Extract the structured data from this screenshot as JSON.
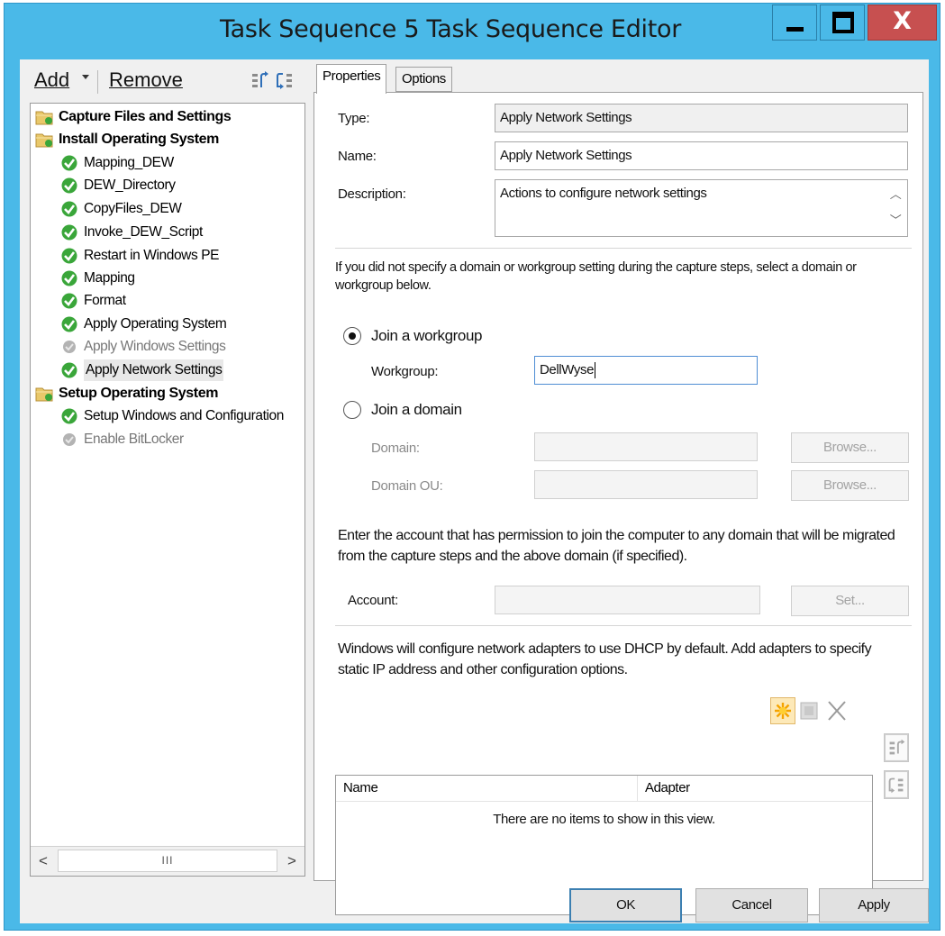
{
  "window": {
    "title": "Task Sequence 5 Task Sequence Editor",
    "minimize_glyph": "",
    "close_glyph": "X"
  },
  "toolbar": {
    "add_label": "Add",
    "remove_label": "Remove"
  },
  "tree": {
    "groups": [
      {
        "label": "Capture Files and Settings"
      },
      {
        "label": "Install Operating System"
      },
      {
        "label": "Setup Operating System"
      }
    ],
    "steps": [
      {
        "label": "Mapping_DEW",
        "status": "check"
      },
      {
        "label": "DEW_Directory",
        "status": "check"
      },
      {
        "label": "CopyFiles_DEW",
        "status": "check"
      },
      {
        "label": "Invoke_DEW_Script",
        "status": "check"
      },
      {
        "label": "Restart in Windows PE",
        "status": "check"
      },
      {
        "label": "Mapping",
        "status": "check"
      },
      {
        "label": "Format",
        "status": "check"
      },
      {
        "label": "Apply Operating System",
        "status": "check"
      },
      {
        "label": "Apply Windows Settings",
        "status": "disabled"
      },
      {
        "label": "Apply Network Settings",
        "status": "check",
        "selected": true
      },
      {
        "label": "Setup Windows and Configuration",
        "status": "check"
      },
      {
        "label": "Enable BitLocker",
        "status": "disabled"
      }
    ],
    "scroll": {
      "left": "<",
      "thumb": "III",
      "right": ">"
    }
  },
  "tabs": [
    {
      "label": "Properties",
      "active": true
    },
    {
      "label": "Options",
      "active": false
    }
  ],
  "properties": {
    "type_label": "Type:",
    "type_value": "Apply Network Settings",
    "name_label": "Name:",
    "name_value": "Apply Network Settings",
    "description_label": "Description:",
    "description_value": "Actions to configure network settings",
    "domain_help": "If you did not specify a domain or workgroup setting during the capture steps, select a domain or workgroup below.",
    "join_workgroup_label": "Join a workgroup",
    "workgroup_label": "Workgroup:",
    "workgroup_value": "DellWyse",
    "join_domain_label": "Join a domain",
    "domain_label": "Domain:",
    "domain_ou_label": "Domain OU:",
    "browse_label": "Browse...",
    "account_help": "Enter the account that has permission to join the computer to any domain that will be migrated from the capture steps and the above domain (if specified).",
    "account_label": "Account:",
    "set_label": "Set...",
    "adapters_help": "Windows will configure network adapters to use DHCP by default. Add adapters to specify static IP address and other configuration options.",
    "adapters_columns": [
      "Name",
      "Adapter"
    ],
    "adapters_empty": "There are no items to show in this view.",
    "selected_option": "workgroup"
  },
  "footer": {
    "ok_label": "OK",
    "cancel_label": "Cancel",
    "apply_label": "Apply"
  },
  "colors": {
    "title_bar": "#4ab9e8",
    "close_button": "#c75050",
    "check_green": "#3aa63a"
  }
}
